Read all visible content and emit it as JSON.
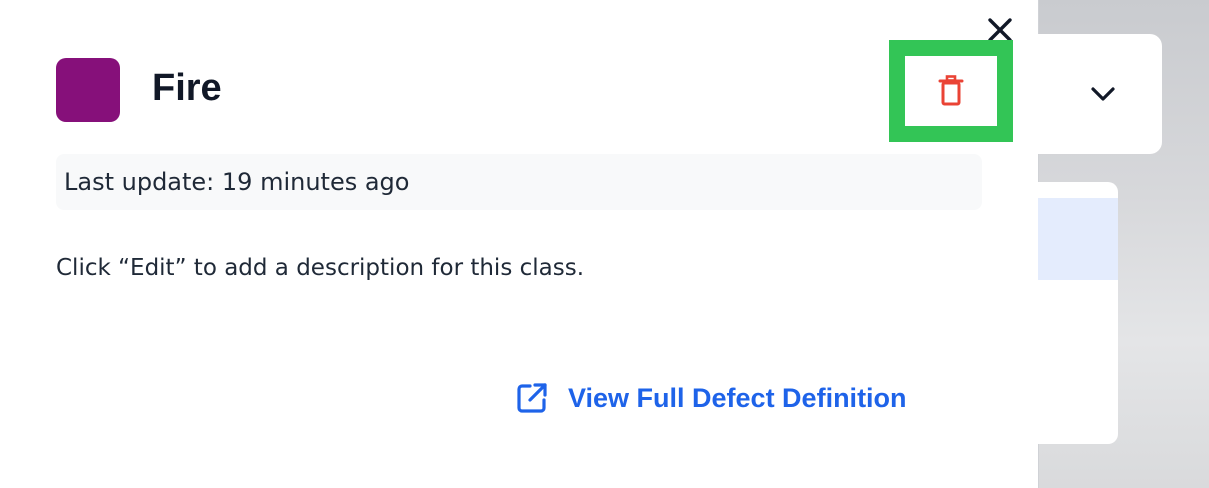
{
  "drawer": {
    "title": "Fire",
    "swatch_color": "#86107a",
    "last_update": "Last update: 19 minutes ago",
    "description": "Click “Edit” to add a description for this class.",
    "link_label": "View Full Defect Definition",
    "icons": {
      "close": "close-icon",
      "delete": "trash-icon",
      "external_link": "external-link-icon"
    },
    "colors": {
      "delete_icon": "#ea4335",
      "link": "#1e63e9",
      "highlight": "#33c556"
    }
  },
  "background": {
    "dropdown_icon": "chevron-down-icon"
  }
}
